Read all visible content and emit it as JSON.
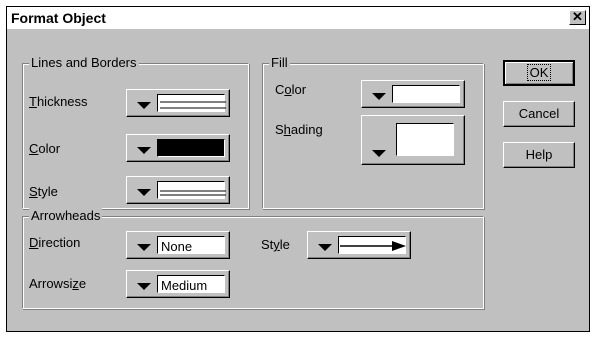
{
  "window": {
    "title": "Format Object",
    "close_glyph": "✕"
  },
  "lines_borders": {
    "legend": "Lines and Borders",
    "thickness_label": "Thickness",
    "thickness_key": "T",
    "color_label": "Color",
    "color_key": "C",
    "style_label": "Style",
    "style_key": "S",
    "color_value": "#000000"
  },
  "fill": {
    "legend": "Fill",
    "color_label": "Color",
    "color_key": "o",
    "shading_label": "Shading",
    "shading_key": "h"
  },
  "arrowheads": {
    "legend": "Arrowheads",
    "direction_label": "Direction",
    "direction_key": "D",
    "direction_value": "None",
    "arrowsize_label": "Arrowsize",
    "arrowsize_key": "z",
    "arrowsize_value": "Medium",
    "style_label": "Style",
    "style_key": "y"
  },
  "buttons": {
    "ok": "OK",
    "cancel": "Cancel",
    "help": "Help"
  }
}
